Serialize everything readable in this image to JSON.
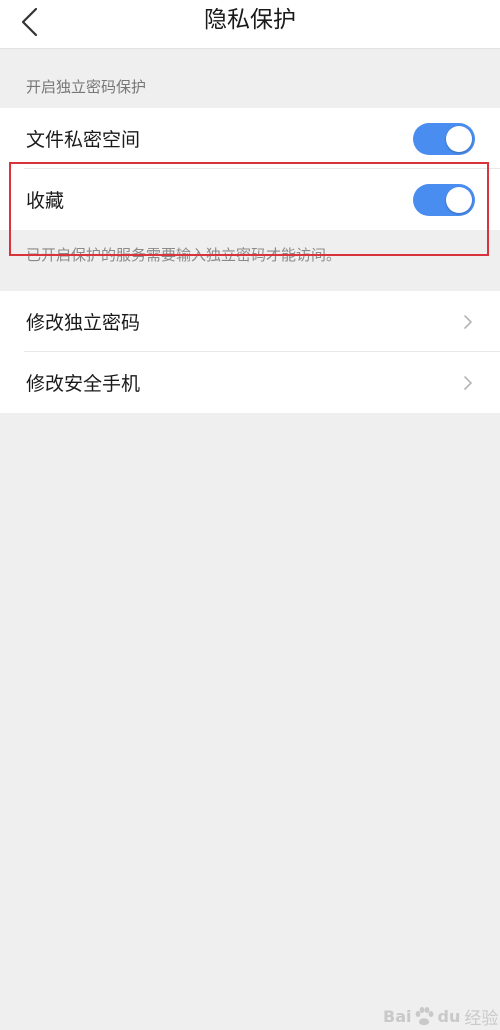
{
  "header": {
    "title": "隐私保护",
    "back_icon": "chevron-left-icon"
  },
  "protection": {
    "caption": "开启独立密码保护",
    "items": [
      {
        "label": "文件私密空间",
        "enabled": true
      },
      {
        "label": "收藏",
        "enabled": true
      }
    ],
    "hint": "已开启保护的服务需要输入独立密码才能访问。"
  },
  "settings": {
    "items": [
      {
        "label": "修改独立密码",
        "icon": "chevron-right-icon"
      },
      {
        "label": "修改安全手机",
        "icon": "chevron-right-icon"
      }
    ]
  },
  "watermark": {
    "text_left": "Bai",
    "text_mid": "du",
    "text_cn": "经验"
  },
  "colors": {
    "accent": "#4a8df0",
    "highlight": "#d9343c",
    "background": "#efefef"
  }
}
